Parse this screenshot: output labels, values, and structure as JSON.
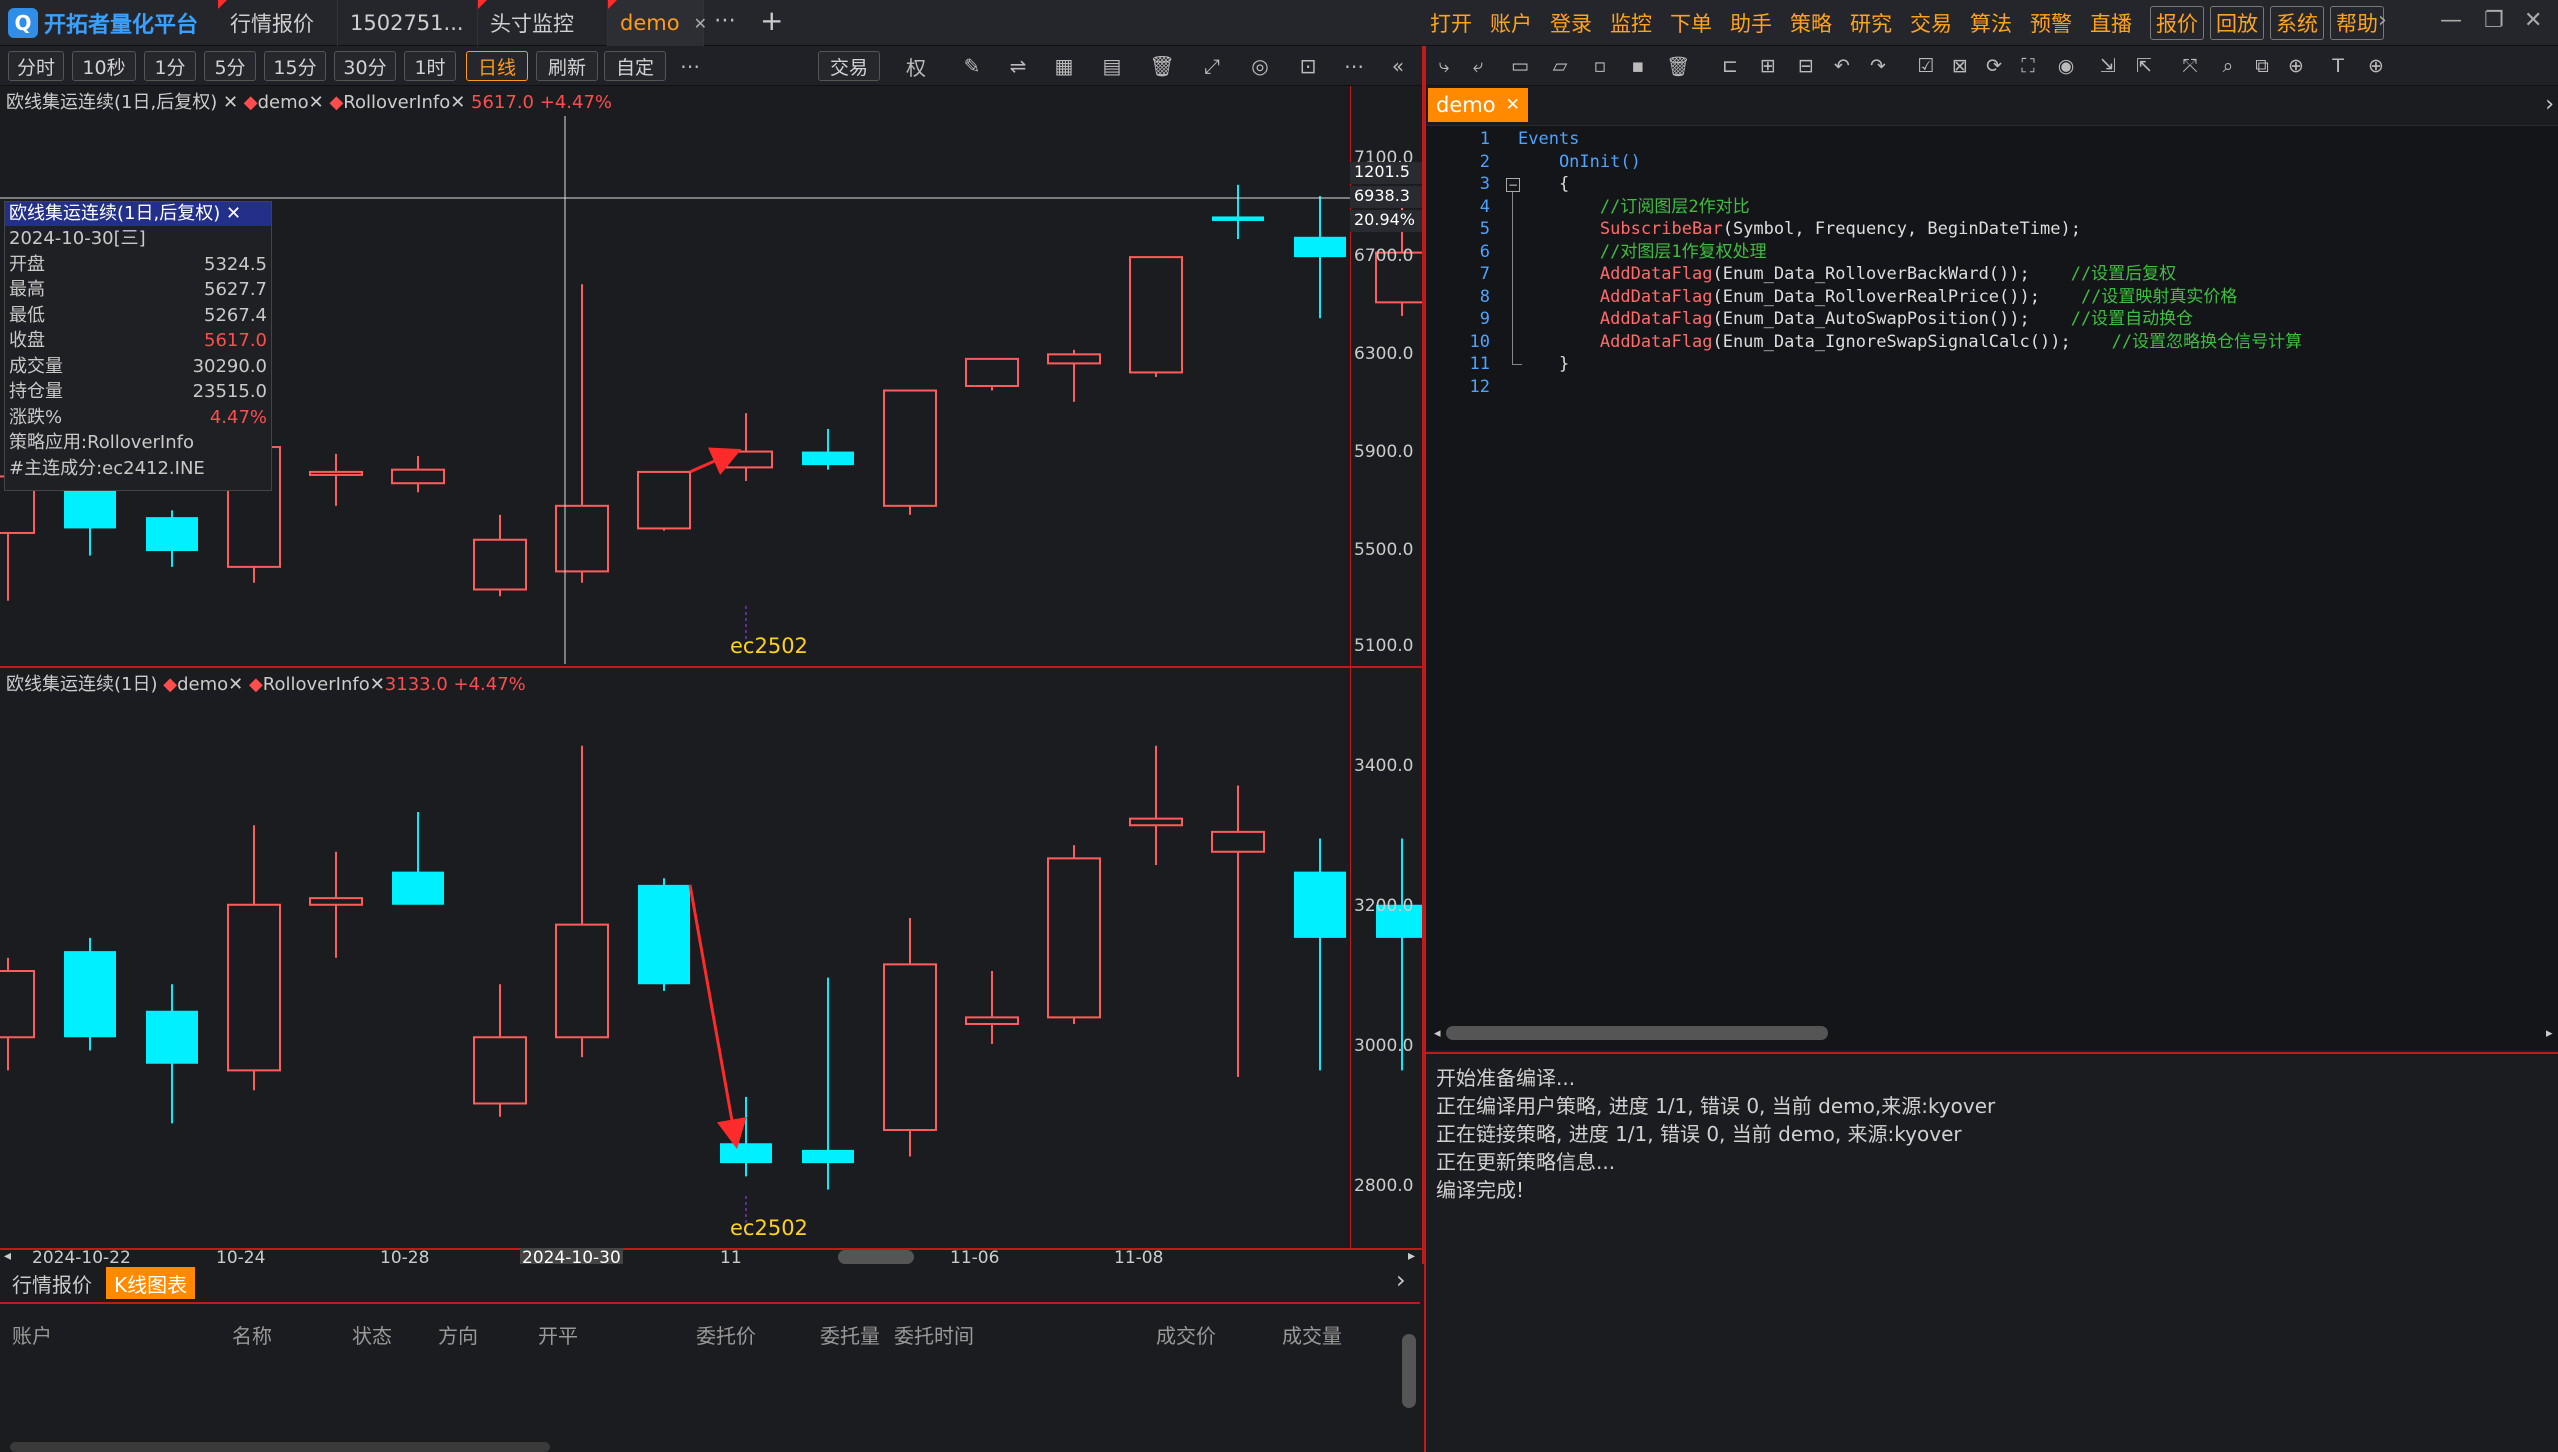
{
  "app": {
    "name": "开拓者量化平台"
  },
  "tabs": [
    {
      "label": "行情报价"
    },
    {
      "label": "1502751..."
    },
    {
      "label": "头寸监控"
    },
    {
      "label": "demo"
    }
  ],
  "menu": [
    "打开",
    "账户",
    "登录",
    "监控",
    "下单",
    "助手",
    "策略",
    "研究",
    "交易",
    "算法",
    "预警",
    "直播",
    "报价",
    "回放",
    "系统",
    "帮助"
  ],
  "toolbar": {
    "periods": [
      "分时",
      "10秒",
      "1分",
      "5分",
      "15分",
      "30分",
      "1时",
      "日线",
      "刷新",
      "自定"
    ],
    "trade": "交易",
    "quan": "权"
  },
  "pane1": {
    "title": "欧线集运连续(1日,后复权)",
    "ind1": "demo",
    "ind2": "RolloverInfo",
    "price": "5617.0",
    "chg": "+4.47%",
    "annot": "ec2502"
  },
  "pane2": {
    "title": "欧线集运连续(1日)",
    "ind1": "demo",
    "ind2": "RolloverInfo",
    "price": "3133.0",
    "chg": "+4.47%",
    "annot": "ec2502"
  },
  "info": {
    "title": "欧线集运连续(1日,后复权)",
    "date": "2024-10-30[三]",
    "rows": [
      [
        "开盘",
        "5324.5"
      ],
      [
        "最高",
        "5627.7"
      ],
      [
        "最低",
        "5267.4"
      ],
      [
        "收盘",
        "5617.0"
      ],
      [
        "成交量",
        "30290.0"
      ],
      [
        "持仓量",
        "23515.0"
      ],
      [
        "涨跌%",
        "4.47%"
      ]
    ],
    "strategy": "策略应用:RolloverInfo",
    "main": "#主连成分:ec2412.INE"
  },
  "cursor": {
    "v1": "1201.5",
    "v2": "6938.3",
    "v3": "20.94%"
  },
  "y1": [
    "7100.0",
    "6700.0",
    "6300.0",
    "5900.0",
    "5500.0",
    "5100.0"
  ],
  "y2": [
    "3400.0",
    "3200.0",
    "3000.0",
    "2800.0"
  ],
  "xaxis": [
    "2024-10-22",
    "10-24",
    "10-28",
    "2024-10-30",
    "11",
    "11-06",
    "11-08"
  ],
  "colors": {
    "up": "#ff5c5c",
    "down": "#00f0ff",
    "accent": "#ff8a00",
    "border": "#c01a1a"
  },
  "editor": {
    "tab": "demo",
    "lines": [
      {
        "n": "1",
        "parts": [
          [
            "kw",
            "Events"
          ]
        ]
      },
      {
        "n": "2",
        "parts": [
          [
            "kw",
            "    OnInit()"
          ]
        ]
      },
      {
        "n": "3",
        "parts": [
          [
            "tx",
            "    {"
          ]
        ]
      },
      {
        "n": "4",
        "parts": [
          [
            "cm",
            "        //订阅图层2作对比"
          ]
        ]
      },
      {
        "n": "5",
        "parts": [
          [
            "fn",
            "        SubscribeBar"
          ],
          [
            "tx",
            "(Symbol, Frequency, BeginDateTime);"
          ]
        ]
      },
      {
        "n": "6",
        "parts": [
          [
            "cm",
            "        //对图层1作复权处理"
          ]
        ]
      },
      {
        "n": "7",
        "parts": [
          [
            "fn",
            "        AddDataFlag"
          ],
          [
            "tx",
            "(Enum_Data_RolloverBackWard());    "
          ],
          [
            "cm",
            "//设置后复权"
          ]
        ]
      },
      {
        "n": "8",
        "parts": [
          [
            "fn",
            "        AddDataFlag"
          ],
          [
            "tx",
            "(Enum_Data_RolloverRealPrice());    "
          ],
          [
            "cm",
            "//设置映射真实价格"
          ]
        ]
      },
      {
        "n": "9",
        "parts": [
          [
            "fn",
            "        AddDataFlag"
          ],
          [
            "tx",
            "(Enum_Data_AutoSwapPosition());    "
          ],
          [
            "cm",
            "//设置自动换仓"
          ]
        ]
      },
      {
        "n": "10",
        "parts": [
          [
            "fn",
            "        AddDataFlag"
          ],
          [
            "tx",
            "(Enum_Data_IgnoreSwapSignalCalc());    "
          ],
          [
            "cm",
            "//设置忽略换仓信号计算"
          ]
        ]
      },
      {
        "n": "11",
        "parts": [
          [
            "tx",
            "    }"
          ]
        ]
      },
      {
        "n": "12",
        "parts": [
          [
            "tx",
            ""
          ]
        ]
      }
    ]
  },
  "console": [
    "开始准备编译...",
    "正在编译用户策略, 进度 1/1, 错误 0, 当前 demo,来源:kyover",
    "正在链接策略, 进度 1/1, 错误 0, 当前 demo, 来源:kyover",
    "正在更新策略信息...",
    "编译完成!"
  ],
  "bottom": {
    "tabs": [
      "行情报价",
      "K线图表"
    ],
    "cols": [
      "账户",
      "名称",
      "状态",
      "方向",
      "开平",
      "委托价",
      "委托量",
      "委托时间",
      "成交价",
      "成交量"
    ]
  },
  "chart_data": [
    {
      "type": "candlestick",
      "title": "欧线集运连续(1日,后复权)",
      "ylim": [
        5000,
        7300
      ],
      "candles": [
        [
          5500,
          5900,
          5200,
          5750
        ],
        [
          5750,
          5780,
          5400,
          5520
        ],
        [
          5570,
          5600,
          5350,
          5420
        ],
        [
          5350,
          5940,
          5280,
          5880
        ],
        [
          5760,
          5850,
          5620,
          5770
        ],
        [
          5720,
          5840,
          5680,
          5780
        ],
        [
          5250,
          5580,
          5220,
          5470
        ],
        [
          5330,
          6600,
          5280,
          5620
        ],
        [
          5520,
          5700,
          5510,
          5770
        ],
        [
          5790,
          6030,
          5730,
          5860
        ],
        [
          5860,
          5960,
          5780,
          5800
        ],
        [
          5620,
          6100,
          5580,
          6130
        ],
        [
          6150,
          6150,
          6130,
          6270
        ],
        [
          6250,
          6310,
          6080,
          6290
        ],
        [
          6210,
          6680,
          6190,
          6720
        ],
        [
          6900,
          7040,
          6800,
          6880
        ],
        [
          6810,
          6990,
          6450,
          6720
        ],
        [
          6520,
          6950,
          6460,
          6740
        ]
      ]
    },
    {
      "type": "candlestick",
      "title": "欧线集运连续(1日)",
      "ylim": [
        2700,
        3500
      ],
      "candles": [
        [
          3000,
          3120,
          2950,
          3100
        ],
        [
          3130,
          3150,
          2980,
          3000
        ],
        [
          3040,
          3080,
          2870,
          2960
        ],
        [
          2950,
          3320,
          2920,
          3200
        ],
        [
          3200,
          3280,
          3120,
          3210
        ],
        [
          3250,
          3340,
          3220,
          3200
        ],
        [
          2900,
          3080,
          2880,
          3000
        ],
        [
          3000,
          3440,
          2970,
          3170
        ],
        [
          3230,
          3240,
          3070,
          3080
        ],
        [
          2840,
          2910,
          2790,
          2810
        ],
        [
          2830,
          3090,
          2770,
          2810
        ],
        [
          2860,
          3180,
          2820,
          3110
        ],
        [
          3020,
          3100,
          2990,
          3030
        ],
        [
          3030,
          3290,
          3020,
          3270
        ],
        [
          3320,
          3440,
          3260,
          3330
        ],
        [
          3280,
          3380,
          2940,
          3310
        ],
        [
          3250,
          3300,
          2950,
          3150
        ],
        [
          3200,
          3300,
          2950,
          3150
        ]
      ]
    }
  ]
}
